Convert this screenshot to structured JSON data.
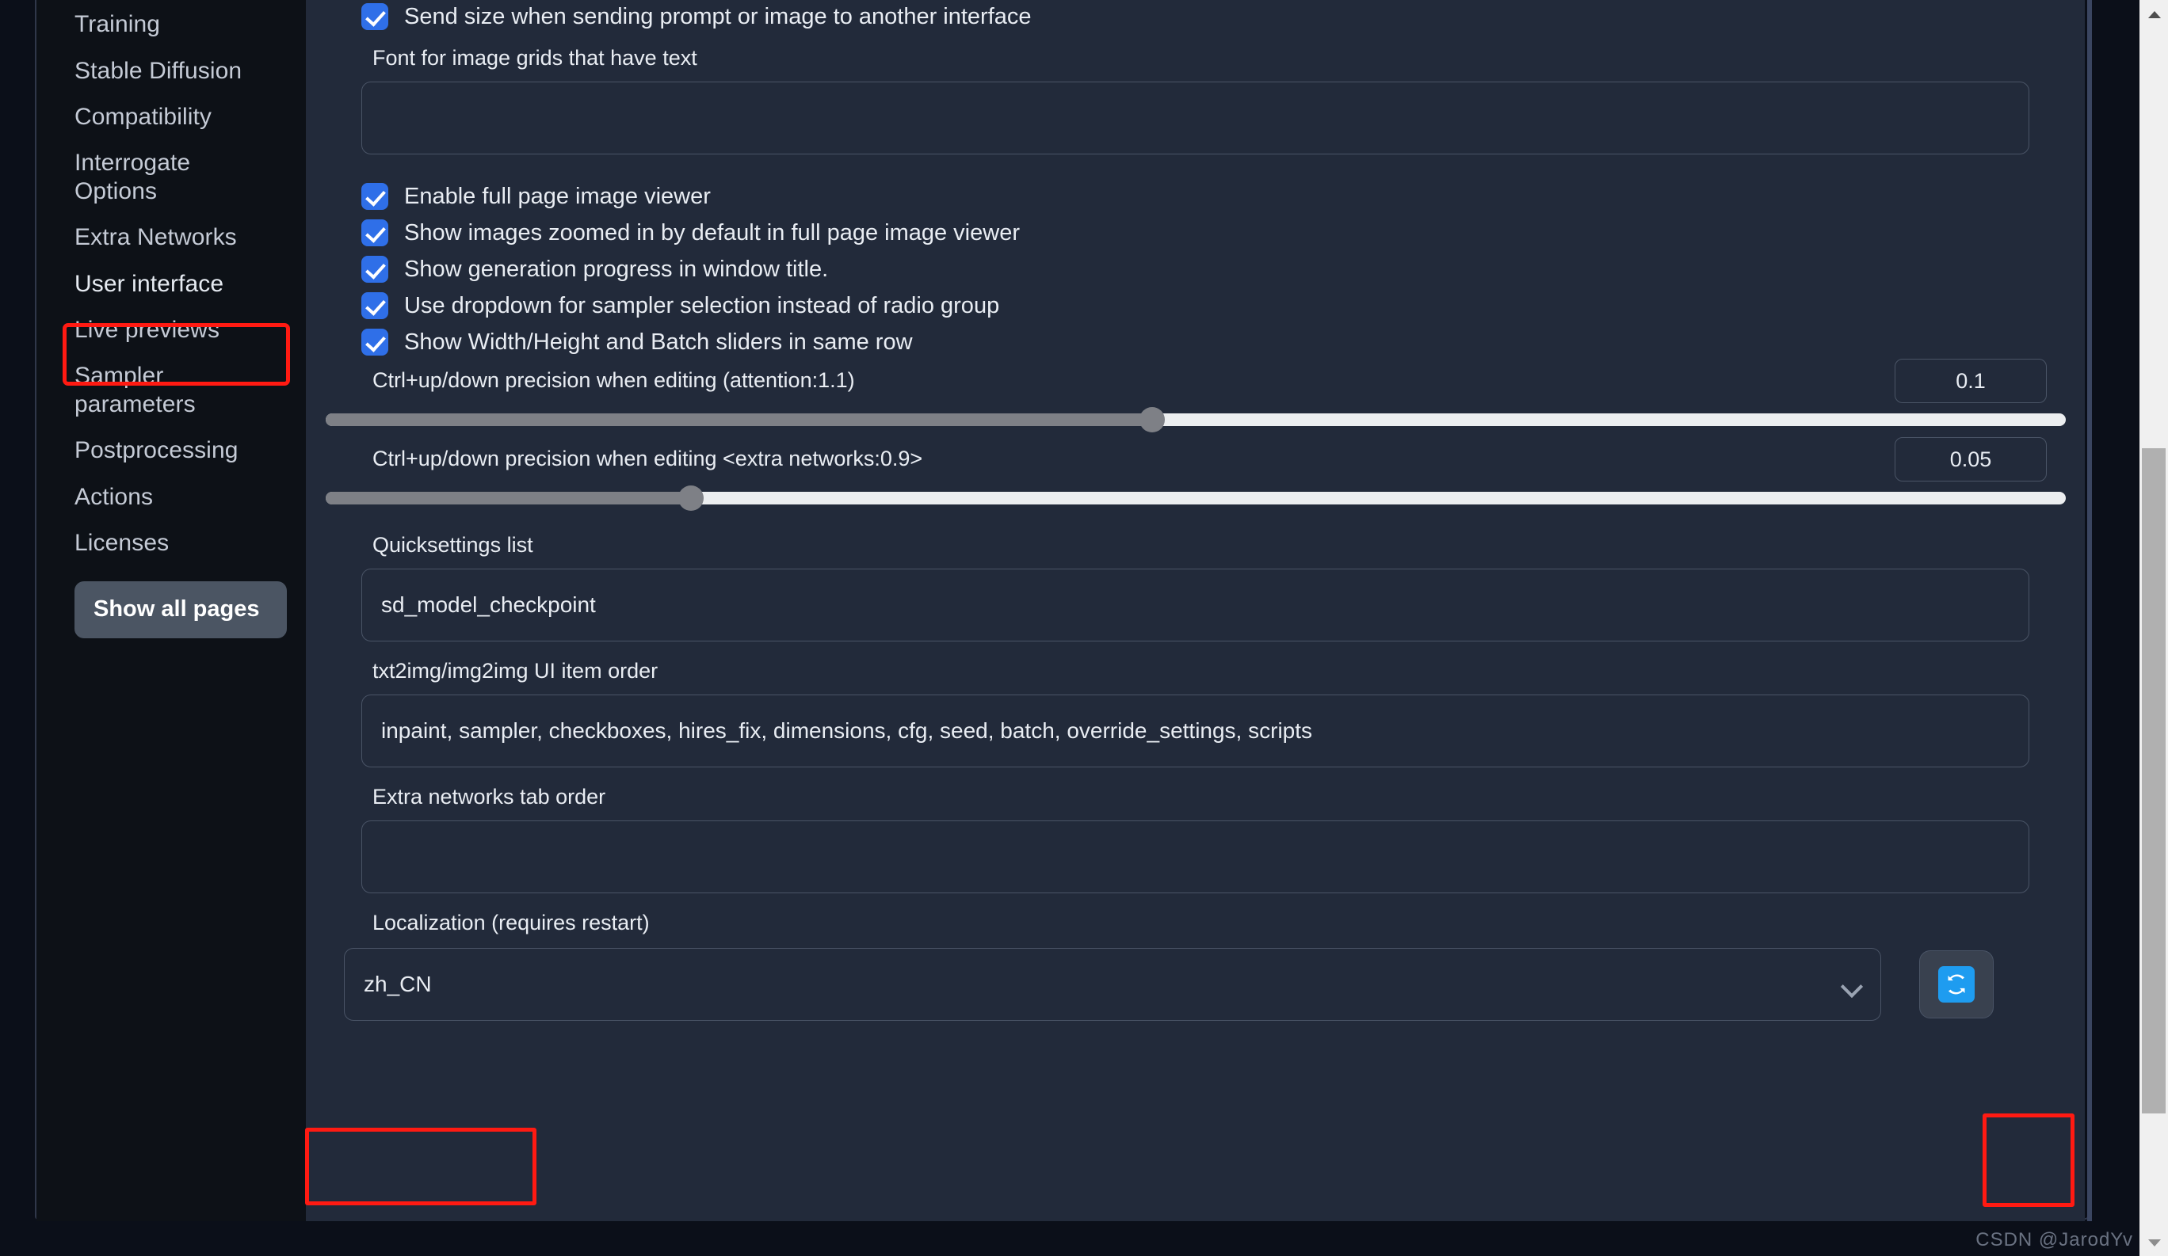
{
  "sidebar": {
    "items": [
      {
        "label": "Training",
        "highlighted": false
      },
      {
        "label": "Stable Diffusion",
        "highlighted": false
      },
      {
        "label": "Compatibility",
        "highlighted": false
      },
      {
        "label": "Interrogate Options",
        "highlighted": false
      },
      {
        "label": "Extra Networks",
        "highlighted": false
      },
      {
        "label": "User interface",
        "highlighted": true
      },
      {
        "label": "Live previews",
        "highlighted": false
      },
      {
        "label": "Sampler parameters",
        "highlighted": false
      },
      {
        "label": "Postprocessing",
        "highlighted": false
      },
      {
        "label": "Actions",
        "highlighted": false
      },
      {
        "label": "Licenses",
        "highlighted": false
      }
    ],
    "show_all_pages_label": "Show all pages"
  },
  "settings": {
    "checkbox_send_size": {
      "label": "Send size when sending prompt or image to another interface",
      "checked": true
    },
    "font_for_grids": {
      "label": "Font for image grids that have text",
      "value": "",
      "placeholder": ""
    },
    "checkbox_full_page_viewer": {
      "label": "Enable full page image viewer",
      "checked": true
    },
    "checkbox_zoomed_default": {
      "label": "Show images zoomed in by default in full page image viewer",
      "checked": true
    },
    "checkbox_progress_title": {
      "label": "Show generation progress in window title.",
      "checked": true
    },
    "checkbox_dropdown_sampler": {
      "label": "Use dropdown for sampler selection instead of radio group",
      "checked": true
    },
    "checkbox_sliders_same_row": {
      "label": "Show Width/Height and Batch sliders in same row",
      "checked": true
    },
    "slider_attention": {
      "label": "Ctrl+up/down precision when editing (attention:1.1)",
      "value": "0.1",
      "percent": 47.5
    },
    "slider_extra_networks": {
      "label": "Ctrl+up/down precision when editing <extra networks:0.9>",
      "value": "0.05",
      "percent": 21.0
    },
    "quicksettings": {
      "label": "Quicksettings list",
      "value": "sd_model_checkpoint"
    },
    "ui_item_order": {
      "label": "txt2img/img2img UI item order",
      "value": "inpaint, sampler, checkboxes, hires_fix, dimensions, cfg, seed, batch, override_settings, scripts"
    },
    "extra_networks_tab_order": {
      "label": "Extra networks tab order",
      "value": ""
    },
    "localization": {
      "label": "Localization (requires restart)",
      "value": "zh_CN",
      "chevron_icon": "chevron-down-icon",
      "refresh_icon": "refresh-icon"
    }
  },
  "colors": {
    "accent_blue": "#2f6fe8",
    "annotation_red": "#ff1a12",
    "refresh_icon_blue": "#1e9cf0",
    "panel_bg": "#222a3a",
    "page_bg": "#0b0f19"
  },
  "watermark": {
    "text": "CSDN @JarodYv"
  }
}
